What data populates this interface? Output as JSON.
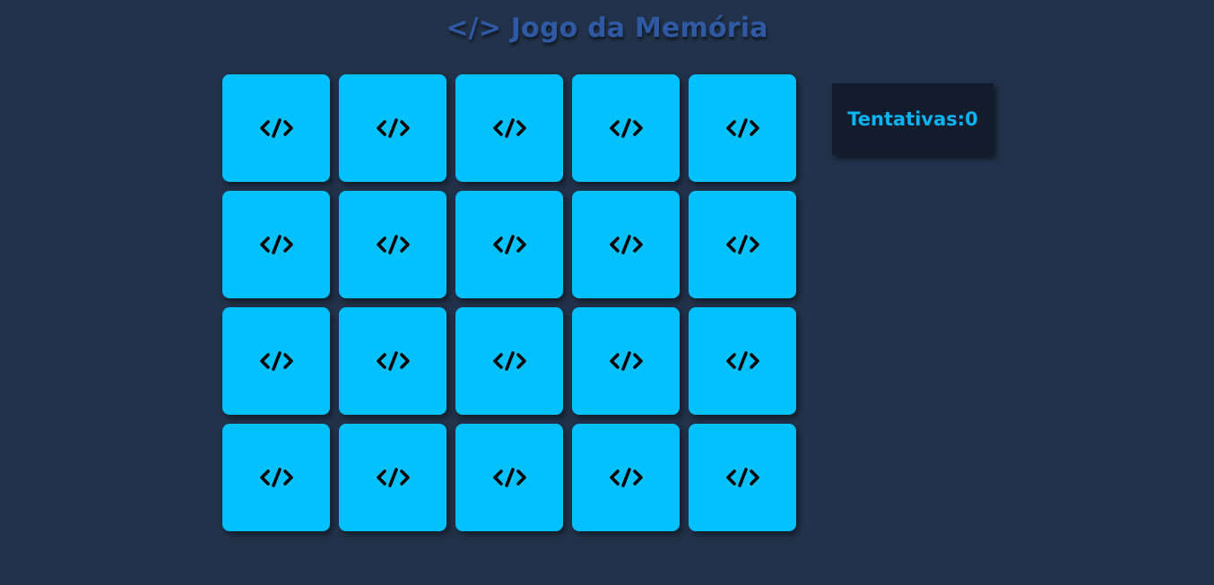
{
  "header": {
    "title": "</> Jogo da Memória"
  },
  "board": {
    "rows": 4,
    "columns": 5,
    "card_count": 20,
    "card_face_icon": "code-icon",
    "card_color": "#03c1fe"
  },
  "score": {
    "label": "Tentativas:",
    "value": "0"
  },
  "colors": {
    "background": "#22324a",
    "title": "#2f5aa3",
    "score_panel": "#121c2c",
    "score_text": "#0bb3f0",
    "icon": "#000000"
  }
}
